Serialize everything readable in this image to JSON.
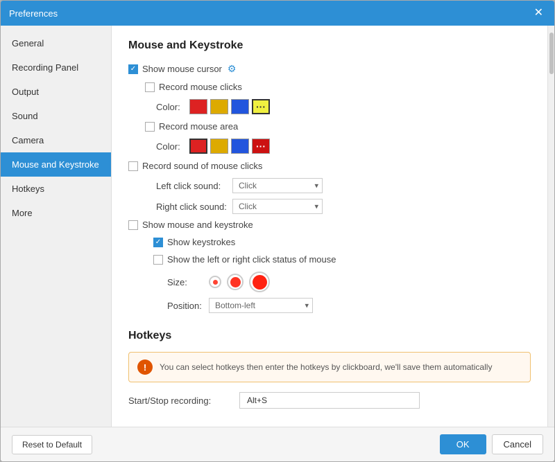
{
  "dialog": {
    "title": "Preferences",
    "close_label": "✕"
  },
  "sidebar": {
    "items": [
      {
        "id": "general",
        "label": "General",
        "active": false
      },
      {
        "id": "recording-panel",
        "label": "Recording Panel",
        "active": false
      },
      {
        "id": "output",
        "label": "Output",
        "active": false
      },
      {
        "id": "sound",
        "label": "Sound",
        "active": false
      },
      {
        "id": "camera",
        "label": "Camera",
        "active": false
      },
      {
        "id": "mouse-keystroke",
        "label": "Mouse and Keystroke",
        "active": true
      },
      {
        "id": "hotkeys",
        "label": "Hotkeys",
        "active": false
      },
      {
        "id": "more",
        "label": "More",
        "active": false
      }
    ]
  },
  "main": {
    "mouse_section_title": "Mouse and Keystroke",
    "show_mouse_cursor_label": "Show mouse cursor",
    "record_mouse_clicks_label": "Record mouse clicks",
    "color_label": "Color:",
    "record_mouse_area_label": "Record mouse area",
    "color_label2": "Color:",
    "record_sound_label": "Record sound of mouse clicks",
    "left_click_sound_label": "Left click sound:",
    "left_click_sound_value": "Click",
    "right_click_sound_label": "Right click sound:",
    "right_click_sound_value": "Click",
    "show_mouse_keystroke_label": "Show mouse and keystroke",
    "show_keystrokes_label": "Show keystrokes",
    "show_lr_click_label": "Show the left or right click status of mouse",
    "size_label": "Size:",
    "position_label": "Position:",
    "position_value": "Bottom-left",
    "hotkeys_section_title": "Hotkeys",
    "hotkeys_info": "You can select hotkeys then enter the hotkeys by clickboard, we'll save them automatically",
    "start_stop_label": "Start/Stop recording:",
    "start_stop_value": "Alt+S",
    "more_dot_dot": "...",
    "swatches1": [
      "#dd2222",
      "#ddaa00",
      "#2255dd"
    ],
    "swatches2": [
      "#dd2222",
      "#ddaa00",
      "#2255dd"
    ],
    "selected_swatch1_index": 3,
    "selected_swatch2_index": 0
  },
  "footer": {
    "reset_label": "Reset to Default",
    "ok_label": "OK",
    "cancel_label": "Cancel"
  }
}
